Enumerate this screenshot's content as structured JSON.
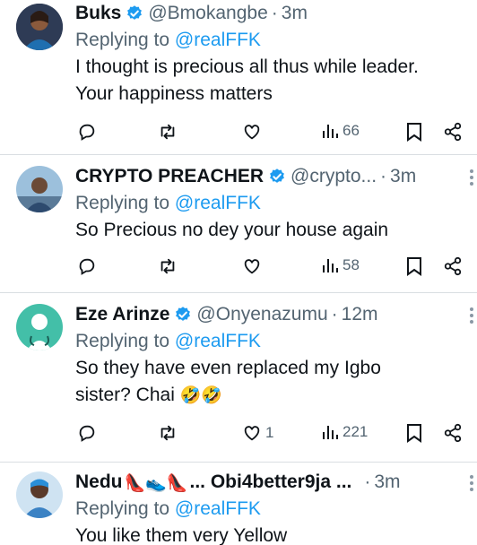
{
  "tweets": [
    {
      "name": "Buks",
      "handle": "@Bmokangbe",
      "time": "3m",
      "reply_prefix": "Replying to",
      "reply_to": "@realFFK",
      "text_line1": "I thought is precious all thus while leader.",
      "text_line2": "Your happiness matters",
      "likes": "",
      "views": "66",
      "avatar_color": "#2b3a52"
    },
    {
      "name": "CRYPTO PREACHER",
      "handle": "@crypto...",
      "time": "3m",
      "reply_prefix": "Replying to",
      "reply_to": "@realFFK",
      "text_line1": "So Precious no dey your house again",
      "likes": "",
      "views": "58",
      "avatar_color": "#7fa4c4"
    },
    {
      "name": "Eze Arinze",
      "handle": "@Onyenazumu",
      "time": "12m",
      "reply_prefix": "Replying to",
      "reply_to": "@realFFK",
      "text_line1": "So they have even replaced my Igbo",
      "text_line2": "sister? Chai",
      "emojis": "🤣🤣",
      "likes": "1",
      "views": "221",
      "avatar_color": "#3fb9a3"
    },
    {
      "name": "Nedu",
      "name_emojis": "👠👟👠",
      "name_suffix": "... Obi4better9ja ...",
      "time": "3m",
      "reply_prefix": "Replying to",
      "reply_to": "@realFFK",
      "text_line1": "You like them very Yellow",
      "avatar_color": "#4a7fb0"
    }
  ],
  "colors": {
    "text": "#0f1419",
    "secondary": "#536471",
    "link": "#1d9bf0",
    "verified": "#1d9bf0"
  }
}
